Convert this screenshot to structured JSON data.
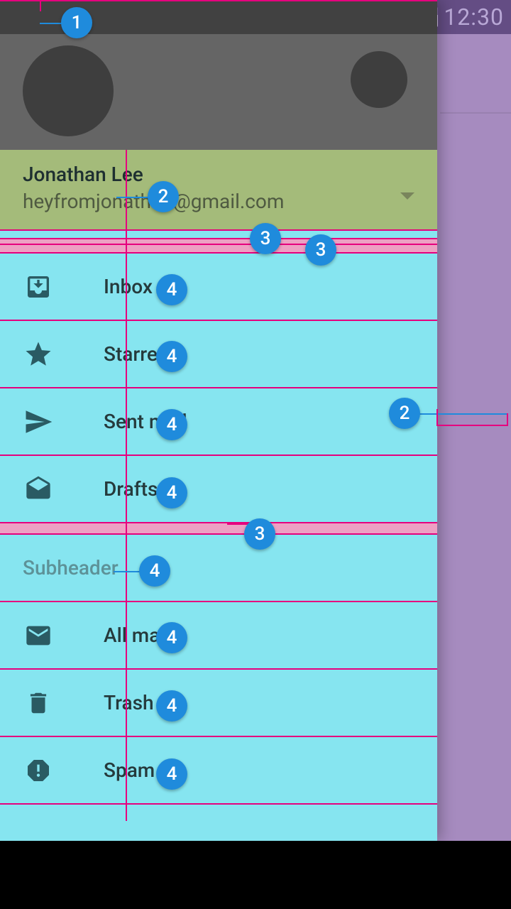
{
  "statusbar": {
    "time": "12:30"
  },
  "account": {
    "name": "Jonathan Lee",
    "email": "heyfromjonathan@gmail.com"
  },
  "nav": {
    "items": [
      {
        "label": "Inbox"
      },
      {
        "label": "Starred"
      },
      {
        "label": "Sent mail"
      },
      {
        "label": "Drafts"
      }
    ],
    "subheader": "Subheader",
    "items2": [
      {
        "label": "All mail"
      },
      {
        "label": "Trash"
      },
      {
        "label": "Spam"
      }
    ]
  },
  "annotations": {
    "b1": "1",
    "b2": "2",
    "b3": "3",
    "b4": "4"
  }
}
